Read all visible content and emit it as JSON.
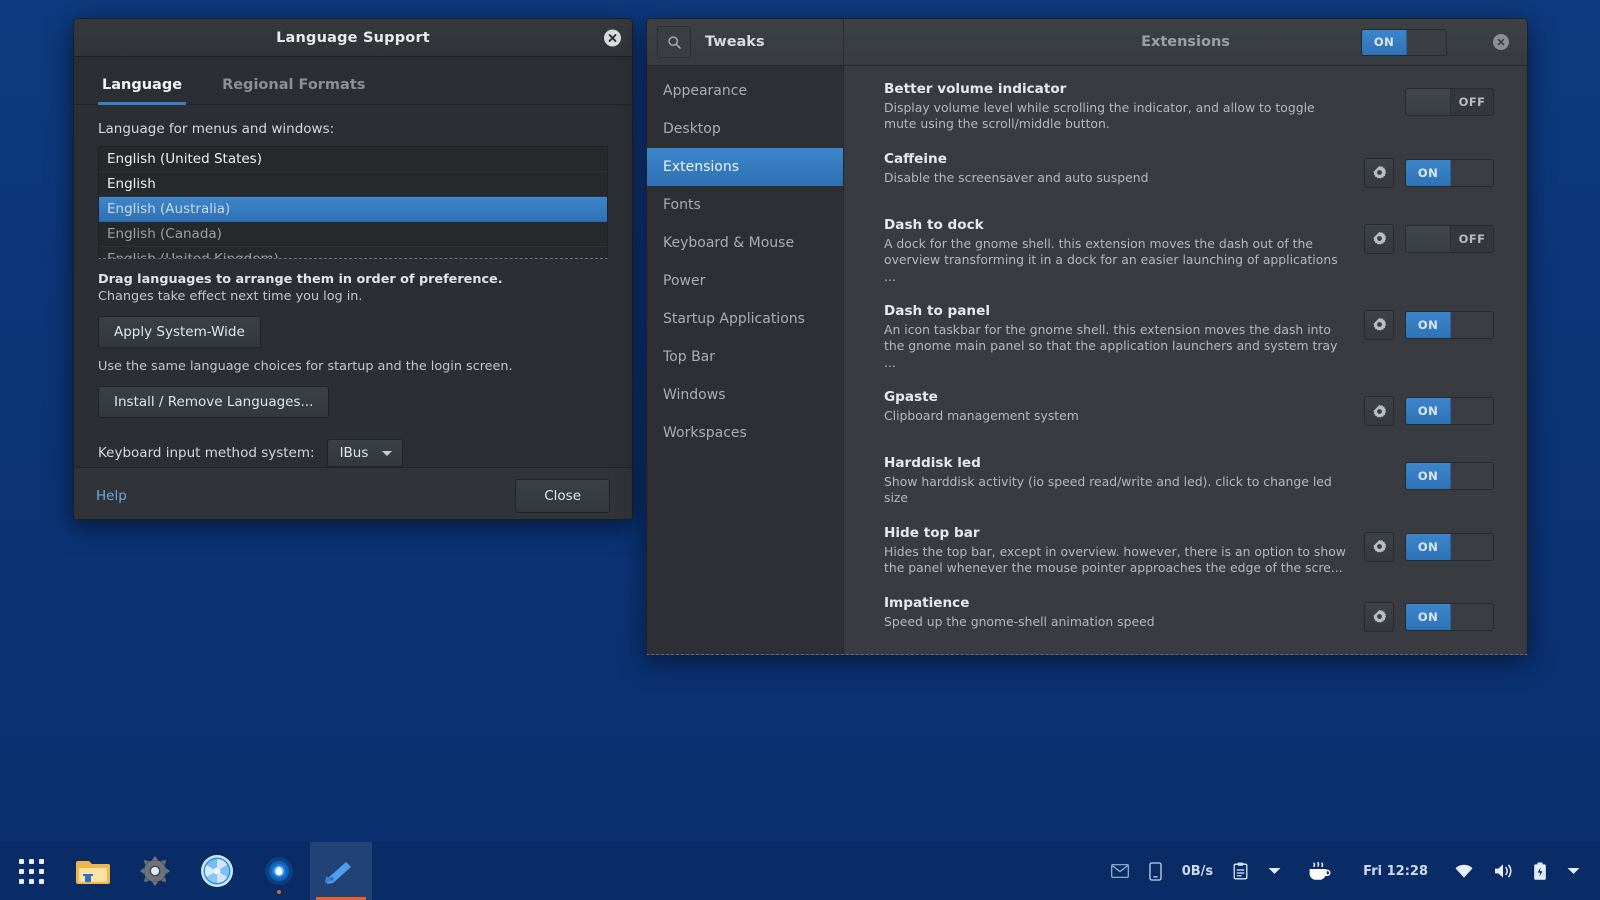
{
  "desktop": {
    "background_color": "#0b3375"
  },
  "language_dialog": {
    "title": "Language Support",
    "close_icon": "close-circle-icon",
    "tabs": [
      {
        "label": "Language",
        "active": true
      },
      {
        "label": "Regional Formats",
        "active": false
      }
    ],
    "list_label": "Language for menus and windows:",
    "languages": [
      {
        "label": "English (United States)",
        "state": "normal"
      },
      {
        "label": "English",
        "state": "normal"
      },
      {
        "label": "English (Australia)",
        "state": "selected"
      },
      {
        "label": "English (Canada)",
        "state": "dim"
      },
      {
        "label": "English (United Kingdom)",
        "state": "dim"
      }
    ],
    "hint_strong": "Drag languages to arrange them in order of preference.",
    "hint": "Changes take effect next time you log in.",
    "apply_button": "Apply System-Wide",
    "login_hint": "Use the same language choices for startup and the login screen.",
    "install_button": "Install / Remove Languages...",
    "keyboard_label": "Keyboard input method system:",
    "keyboard_value": "IBus",
    "help_link": "Help",
    "close_button": "Close"
  },
  "tweaks": {
    "app_title": "Tweaks",
    "panel_title": "Extensions",
    "search_icon": "search-icon",
    "close_icon": "close-circle-icon",
    "header_switch": {
      "state": "on",
      "on_label": "ON",
      "off_label": "OFF"
    },
    "sidebar": [
      {
        "label": "Appearance",
        "active": false
      },
      {
        "label": "Desktop",
        "active": false
      },
      {
        "label": "Extensions",
        "active": true
      },
      {
        "label": "Fonts",
        "active": false
      },
      {
        "label": "Keyboard & Mouse",
        "active": false
      },
      {
        "label": "Power",
        "active": false
      },
      {
        "label": "Startup Applications",
        "active": false
      },
      {
        "label": "Top Bar",
        "active": false
      },
      {
        "label": "Windows",
        "active": false
      },
      {
        "label": "Workspaces",
        "active": false
      }
    ],
    "switch_labels": {
      "on": "ON",
      "off": "OFF"
    },
    "extensions": [
      {
        "name": "Better volume indicator",
        "description": "Display volume level while scrolling the indicator, and allow to toggle mute using the scroll/middle button.",
        "has_settings": false,
        "state": "off"
      },
      {
        "name": "Caffeine",
        "description": "Disable the screensaver and auto suspend",
        "has_settings": true,
        "state": "on"
      },
      {
        "name": "Dash to dock",
        "description": "A dock for the gnome shell. this extension moves the dash out of the overview transforming it in a dock for an easier launching of applications ...",
        "has_settings": true,
        "state": "off"
      },
      {
        "name": "Dash to panel",
        "description": "An icon taskbar for the gnome shell. this extension moves the dash into the gnome main panel so that the application launchers and system tray ...",
        "has_settings": true,
        "state": "on"
      },
      {
        "name": "Gpaste",
        "description": "Clipboard management system",
        "has_settings": true,
        "state": "on"
      },
      {
        "name": "Harddisk led",
        "description": "Show harddisk activity (io speed read/write and led). click to change led size",
        "has_settings": false,
        "state": "on"
      },
      {
        "name": "Hide top bar",
        "description": "Hides the top bar, except in overview. however, there is an option to show the panel whenever the mouse pointer approaches the edge of the scre...",
        "has_settings": true,
        "state": "on"
      },
      {
        "name": "Impatience",
        "description": "Speed up the gnome-shell animation speed",
        "has_settings": true,
        "state": "on"
      }
    ]
  },
  "taskbar": {
    "launcher_icon": "apps-grid-icon",
    "apps": [
      {
        "icon": "file-manager-icon",
        "running": false,
        "active": false
      },
      {
        "icon": "settings-gear-icon",
        "running": false,
        "active": false
      },
      {
        "icon": "shutter-camera-icon",
        "running": false,
        "active": false
      },
      {
        "icon": "water-drop-icon",
        "running": true,
        "active": false
      },
      {
        "icon": "text-editor-icon",
        "running": true,
        "active": true
      }
    ],
    "tray": [
      {
        "icon": "mail-icon",
        "label": ""
      },
      {
        "icon": "phone-icon",
        "label": ""
      },
      {
        "icon": "network-speed-icon",
        "label": "0B/s"
      },
      {
        "icon": "clipboard-icon",
        "label": ""
      },
      {
        "icon": "chevron-down-icon",
        "label": ""
      },
      {
        "icon": "coffee-cup-icon",
        "label": ""
      },
      {
        "icon": "clock-icon",
        "label": "Fri 12:28"
      },
      {
        "icon": "wifi-icon",
        "label": ""
      },
      {
        "icon": "volume-icon",
        "label": ""
      },
      {
        "icon": "battery-icon",
        "label": ""
      },
      {
        "icon": "chevron-down-icon",
        "label": ""
      }
    ]
  }
}
